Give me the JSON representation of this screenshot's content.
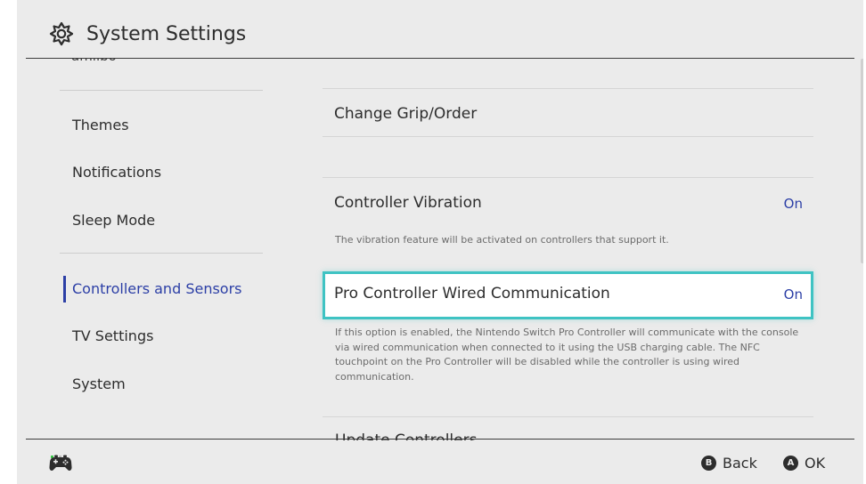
{
  "header": {
    "title": "System Settings",
    "icon": "gear-icon"
  },
  "sidebar": {
    "clipped_item": "amiibo",
    "items": [
      {
        "label": "Themes",
        "selected": false
      },
      {
        "label": "Notifications",
        "selected": false
      },
      {
        "label": "Sleep Mode",
        "selected": false
      },
      {
        "label": "Controllers and Sensors",
        "selected": true
      },
      {
        "label": "TV Settings",
        "selected": false
      },
      {
        "label": "System",
        "selected": false
      }
    ]
  },
  "content": {
    "settings": [
      {
        "label": "Change Grip/Order",
        "value": "",
        "description": ""
      },
      {
        "label": "Controller Vibration",
        "value": "On",
        "description": "The vibration feature will be activated on controllers that support it."
      },
      {
        "label": "Pro Controller Wired Communication",
        "value": "On",
        "focused": true,
        "description": "If this option is enabled, the Nintendo Switch Pro Controller will communicate with the console via wired communication when connected to it using the USB charging cable. The NFC touchpoint on the Pro Controller will be disabled while the controller is using wired communication."
      }
    ],
    "partial_item": "Update Controllers"
  },
  "footer": {
    "controller_icon": "controller-icon",
    "battery_dots": {
      "filled": 1,
      "total": 4
    },
    "back": {
      "button": "B",
      "label": "Back"
    },
    "ok": {
      "button": "A",
      "label": "OK"
    }
  },
  "colors": {
    "background": "#ebebeb",
    "accent_blue": "#2c3fa6",
    "focus_teal": "#3fc3c3",
    "text": "#2d2d2d",
    "description": "#6b6b6b"
  }
}
